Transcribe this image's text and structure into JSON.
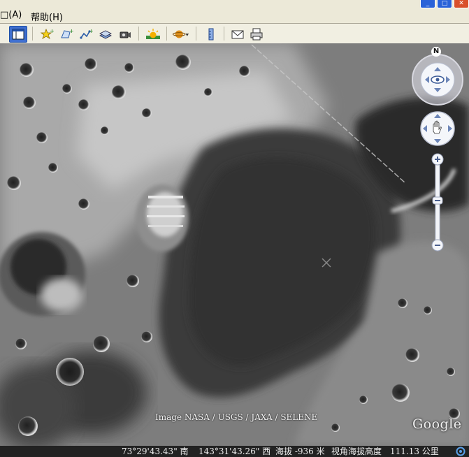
{
  "menu": {
    "items": [
      {
        "label": "□(A)"
      },
      {
        "label": "帮助(H)"
      }
    ]
  },
  "window_controls": [
    "minimize",
    "maximize",
    "close"
  ],
  "toolbar": {
    "buttons": [
      {
        "icon": "sidebar-icon",
        "active": true
      },
      {
        "icon": "add-placemark-icon"
      },
      {
        "icon": "add-polygon-icon"
      },
      {
        "icon": "add-path-icon"
      },
      {
        "icon": "add-image-overlay-icon"
      },
      {
        "icon": "record-tour-icon"
      },
      {
        "icon": "sunlight-icon"
      },
      {
        "icon": "planet-switch-icon"
      },
      {
        "icon": "ruler-icon"
      },
      {
        "icon": "email-icon"
      },
      {
        "icon": "print-icon"
      }
    ]
  },
  "navigation": {
    "north_label": "N"
  },
  "map": {
    "imagery_credit": "Image NASA / USGS / JAXA / SELENE",
    "logo": "Google"
  },
  "status": {
    "latitude": "73°29'43.43\" 南",
    "longitude": "143°31'43.26\" 西",
    "elevation": "海拔 -936 米",
    "eye_alt": "视角海拔高度　111.13 公里"
  },
  "colors": {
    "menubar_bg": "#ece9d8",
    "toolbar_bg": "#f1efe2",
    "active_button": "#3f6fd0",
    "status_bg": "#222222"
  }
}
